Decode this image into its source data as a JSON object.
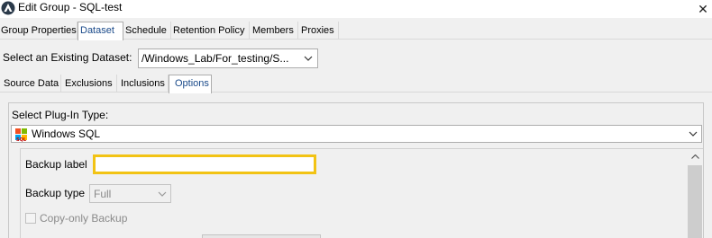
{
  "window": {
    "title": "Edit Group - SQL-test",
    "close_glyph": "✕"
  },
  "main_tabs": [
    {
      "label": "Group Properties",
      "selected": false
    },
    {
      "label": "Dataset",
      "selected": true
    },
    {
      "label": "Schedule",
      "selected": false
    },
    {
      "label": "Retention Policy",
      "selected": false
    },
    {
      "label": "Members",
      "selected": false
    },
    {
      "label": "Proxies",
      "selected": false
    }
  ],
  "dataset": {
    "label": "Select an Existing Dataset:",
    "value": "/Windows_Lab/For_testing/S..."
  },
  "sub_tabs": [
    {
      "label": "Source Data",
      "selected": false
    },
    {
      "label": "Exclusions",
      "selected": false
    },
    {
      "label": "Inclusions",
      "selected": false
    },
    {
      "label": "Options",
      "selected": true
    }
  ],
  "plugin": {
    "label": "Select Plug-In Type:",
    "value": "Windows SQL",
    "icon": "windows-sql-icon"
  },
  "options": {
    "backup_label": "Backup label",
    "backup_label_value": "",
    "backup_type_label": "Backup type",
    "backup_type_value": "Full",
    "copy_only_label": "Copy-only Backup",
    "copy_only_checked": false
  },
  "colors": {
    "focus_border": "#f2c314",
    "selected_tab_text": "#1a4a8a",
    "disabled_text": "#8a8a8a"
  }
}
